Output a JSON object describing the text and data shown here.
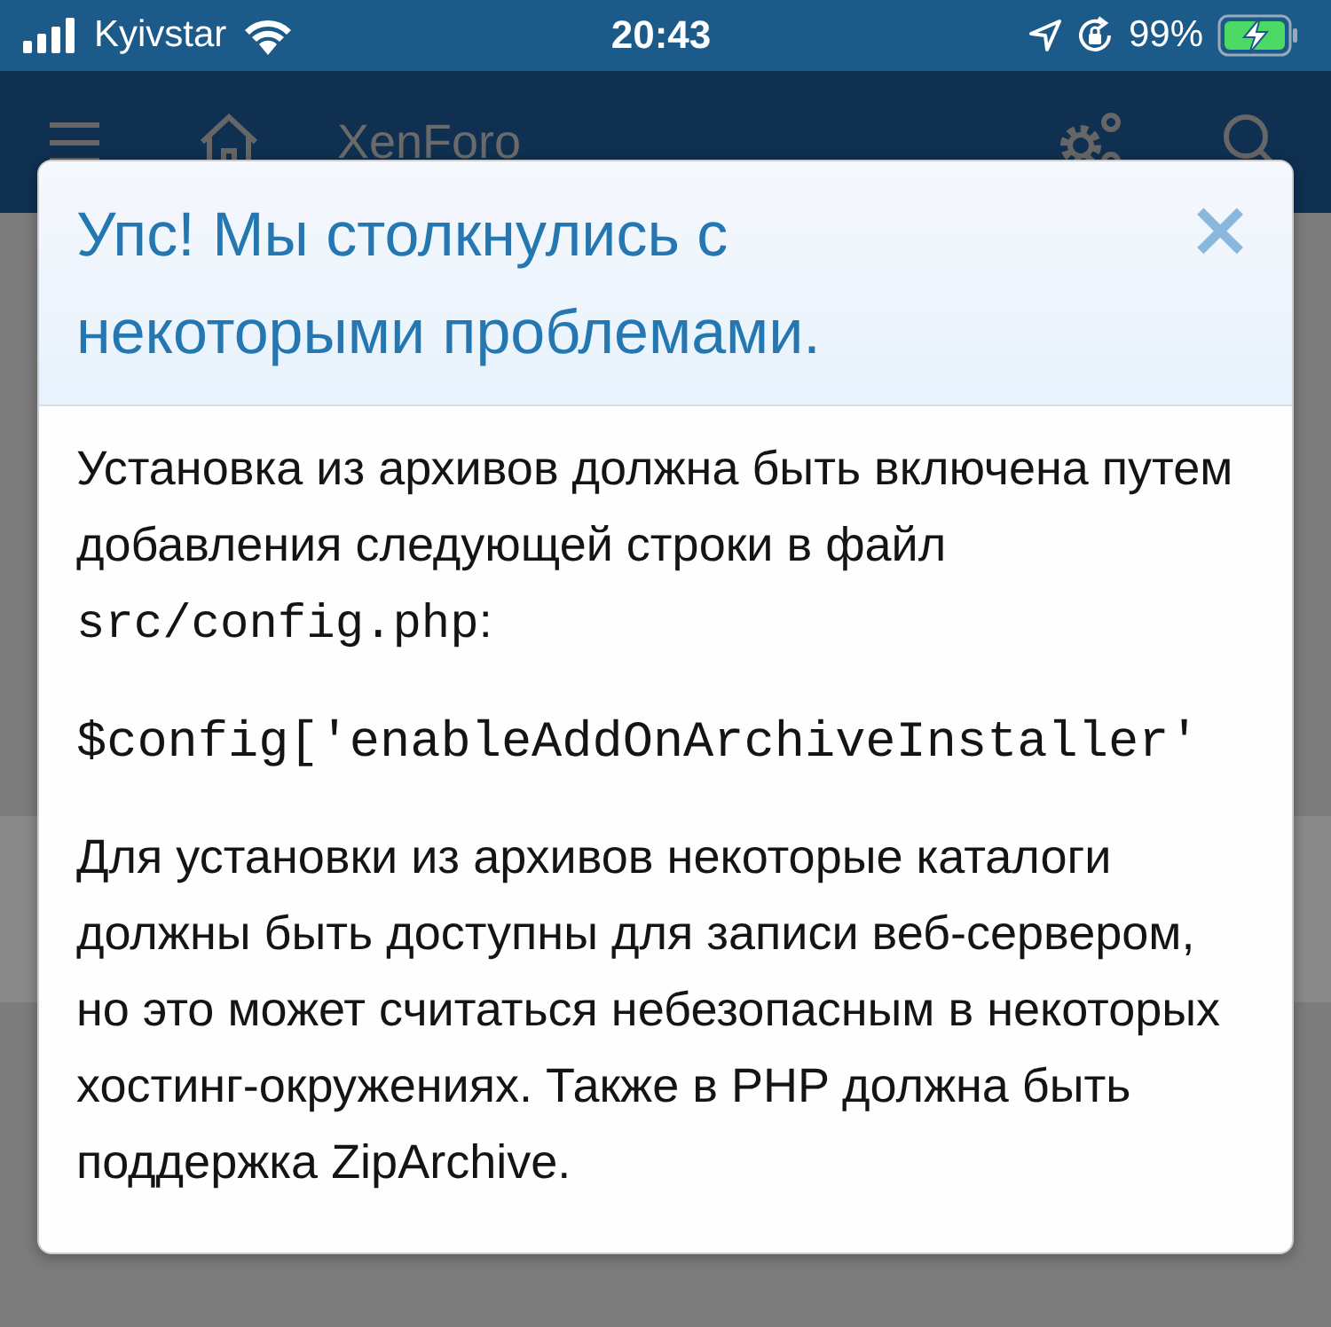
{
  "status_bar": {
    "carrier": "Kyivstar",
    "time": "20:43",
    "battery": "99%"
  },
  "header": {
    "title": "XenForo"
  },
  "dialog": {
    "title": "Упс! Мы столкнулись с некоторыми проблемами.",
    "close": "×",
    "paragraphs": [
      {
        "kind": "text",
        "parts": [
          {
            "kind": "plain",
            "text": "Установка из архивов должна быть включена путем добавления следующей строки в файл "
          },
          {
            "kind": "mono",
            "text": "src/config.php"
          },
          {
            "kind": "plain",
            "text": ":"
          }
        ]
      },
      {
        "kind": "code",
        "text": "$config['enableAddOnArchiveInstaller'"
      },
      {
        "kind": "text",
        "parts": [
          {
            "kind": "plain",
            "text": "Для установки из архивов некоторые каталоги должны быть доступны для записи веб-сервером, но это может считаться небезопасным в некоторых хостинг-окружениях. Также в PHP должна быть поддержка ZipArchive."
          }
        ]
      }
    ]
  }
}
